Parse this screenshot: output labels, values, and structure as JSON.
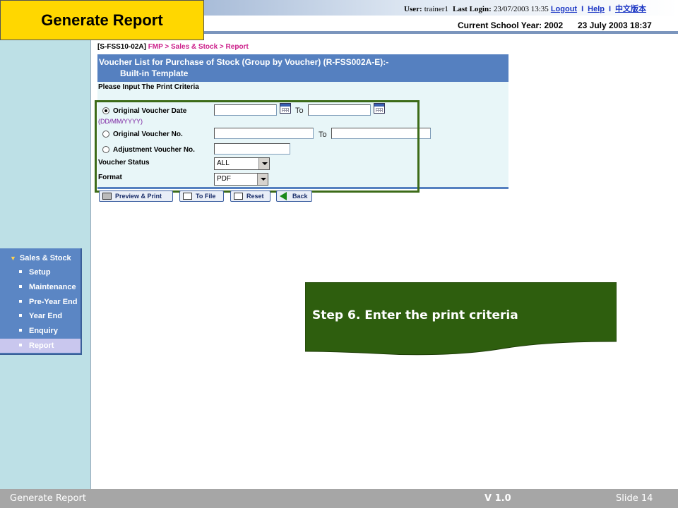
{
  "header": {
    "title": "Generate Report",
    "user_label": "User:",
    "user_name": "trainer1",
    "last_login_label": "Last Login:",
    "last_login_value": "23/07/2003 13:35",
    "logout": "Logout",
    "help": "Help",
    "chinese": "中文版本",
    "separator": "I",
    "school_year": "Current School Year: 2002",
    "datetime": "23 July 2003 18:37"
  },
  "breadcrumb": {
    "code": "[S-FSS10-02A]",
    "path": "FMP > Sales & Stock > Report"
  },
  "form": {
    "title_line1": "Voucher List for Purchase of Stock (Group by Voucher) (R-FSS002A-E):-",
    "title_line2": "Built-in Template",
    "subheading": "Please Input The Print Criteria",
    "original_voucher_date": "Original Voucher Date",
    "date_format_hint": "(DD/MM/YYYY)",
    "to": "To",
    "original_voucher_no": "Original Voucher No.",
    "adjustment_voucher_no": "Adjustment Voucher No.",
    "voucher_status_label": "Voucher Status",
    "voucher_status_value": "ALL",
    "format_label": "Format",
    "format_value": "PDF"
  },
  "buttons": {
    "preview_print": "Preview & Print",
    "to_file": "To File",
    "reset": "Reset",
    "back": "Back"
  },
  "menu": {
    "heading": "Sales & Stock",
    "items": [
      "Setup",
      "Maintenance",
      "Pre-Year End",
      "Year End",
      "Enquiry",
      "Report"
    ],
    "active": "Report"
  },
  "callout": {
    "text": "Step 6. Enter the print criteria"
  },
  "footer": {
    "left": "Generate Report",
    "version": "V 1.0",
    "slide": "Slide 14"
  },
  "colors": {
    "title_badge": "#ffd700",
    "panel_header": "#5580c0",
    "callout": "#2e5e0e",
    "highlight_border": "#3c6b18"
  }
}
